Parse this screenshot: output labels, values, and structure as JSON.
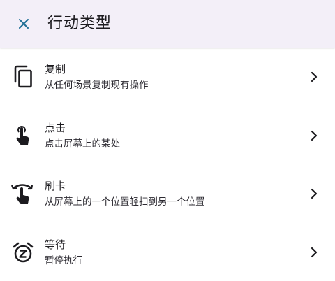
{
  "header": {
    "title": "行动类型",
    "close_icon": "close-icon"
  },
  "colors": {
    "app_bar_bg": "#f3eff8",
    "close_icon": "#1f6f95",
    "text_primary": "#1c1b1f",
    "icon": "#1c1b1f"
  },
  "actions": [
    {
      "label": "复制",
      "description": "从任何场景复制现有操作",
      "icon": "copy-icon"
    },
    {
      "label": "点击",
      "description": "点击屏幕上的某处",
      "icon": "tap-gesture-icon"
    },
    {
      "label": "刷卡",
      "description": "从屏幕上的一个位置轻扫到另一个位置",
      "icon": "swipe-gesture-icon"
    },
    {
      "label": "等待",
      "description": "暂停执行",
      "icon": "snooze-alarm-icon"
    }
  ]
}
